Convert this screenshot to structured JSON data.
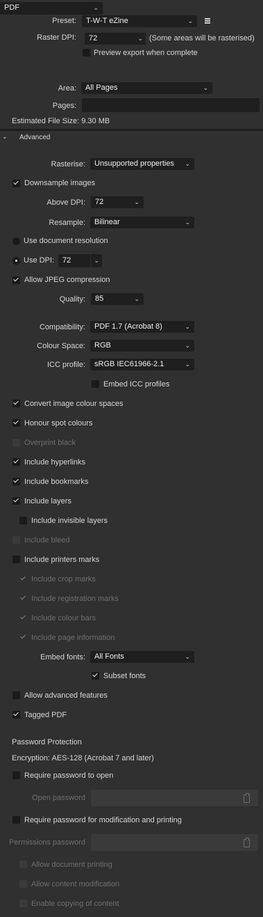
{
  "format": {
    "value": "PDF"
  },
  "preset": {
    "label": "Preset:",
    "value": "T-W-T eZine",
    "menu_icon": "hamburger-menu-icon"
  },
  "raster_dpi": {
    "label": "Raster DPI:",
    "value": "72",
    "note": "(Some areas will be rasterised)"
  },
  "preview_export": {
    "label": "Preview export when complete",
    "checked": false
  },
  "area": {
    "label": "Area:",
    "value": "All Pages"
  },
  "pages": {
    "label": "Pages:",
    "value": ""
  },
  "estimated_size": "Estimated File Size: 9.30 MB",
  "advanced": {
    "title": "Advanced"
  },
  "rasterise": {
    "label": "Rasterise:",
    "value": "Unsupported properties"
  },
  "downsample": {
    "label": "Downsample images",
    "checked": true
  },
  "above_dpi": {
    "label": "Above DPI:",
    "value": "72"
  },
  "resample": {
    "label": "Resample:",
    "value": "Bilinear"
  },
  "use_doc_res": {
    "label": "Use document resolution"
  },
  "use_dpi": {
    "label": "Use DPI:",
    "value": "72"
  },
  "jpeg": {
    "label": "Allow JPEG compression",
    "checked": true
  },
  "quality": {
    "label": "Quality:",
    "value": "85"
  },
  "compatibility": {
    "label": "Compatibility:",
    "value": "PDF 1.7 (Acrobat 8)"
  },
  "colour_space": {
    "label": "Colour Space:",
    "value": "RGB"
  },
  "icc_profile": {
    "label": "ICC profile:",
    "value": "sRGB IEC61966-2.1"
  },
  "embed_icc": {
    "label": "Embed ICC profiles",
    "checked": false
  },
  "options": {
    "convert_colour": "Convert image colour spaces",
    "spot_colours": "Honour spot colours",
    "overprint_black": "Overprint black",
    "hyperlinks": "Include hyperlinks",
    "bookmarks": "Include bookmarks",
    "layers": "Include layers",
    "invisible_layers": "Include invisible layers",
    "bleed": "Include bleed",
    "printers_marks": "Include printers marks",
    "crop_marks": "Include crop marks",
    "registration_marks": "Include registration marks",
    "colour_bars": "Include colour bars",
    "page_information": "Include page information"
  },
  "embed_fonts": {
    "label": "Embed fonts:",
    "value": "All Fonts"
  },
  "subset_fonts": {
    "label": "Subset fonts",
    "checked": true
  },
  "advanced_features": {
    "label": "Allow advanced features",
    "checked": false
  },
  "tagged_pdf": {
    "label": "Tagged PDF",
    "checked": true
  },
  "password": {
    "title": "Password Protection",
    "encryption": "Encryption: AES-128 (Acrobat 7 and later)",
    "require_open": "Require password to open",
    "open_label": "Open password",
    "require_modify": "Require password for modification and printing",
    "permissions_label": "Permissions password",
    "allow_printing": "Allow document printing",
    "allow_modification": "Allow content modification",
    "allow_copying": "Enable copying of content"
  }
}
